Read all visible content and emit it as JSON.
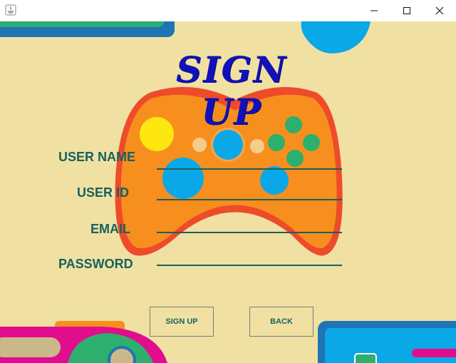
{
  "window": {
    "controls": {
      "minimize_icon": "minimize-icon",
      "maximize_icon": "maximize-icon",
      "close_icon": "close-icon"
    }
  },
  "form": {
    "title": "SIGN UP",
    "fields": [
      {
        "label": "USER NAME",
        "value": ""
      },
      {
        "label": "USER ID",
        "value": ""
      },
      {
        "label": "EMAIL",
        "value": ""
      },
      {
        "label": "PASSWORD",
        "value": ""
      }
    ],
    "buttons": {
      "sign_up": "SIGN UP",
      "back": "BACK"
    }
  },
  "colors": {
    "background": "#f0e1a2",
    "title": "#1111b8",
    "label": "#16625f",
    "controller_body": "#f78f1e",
    "controller_outline": "#ee4b2b"
  }
}
